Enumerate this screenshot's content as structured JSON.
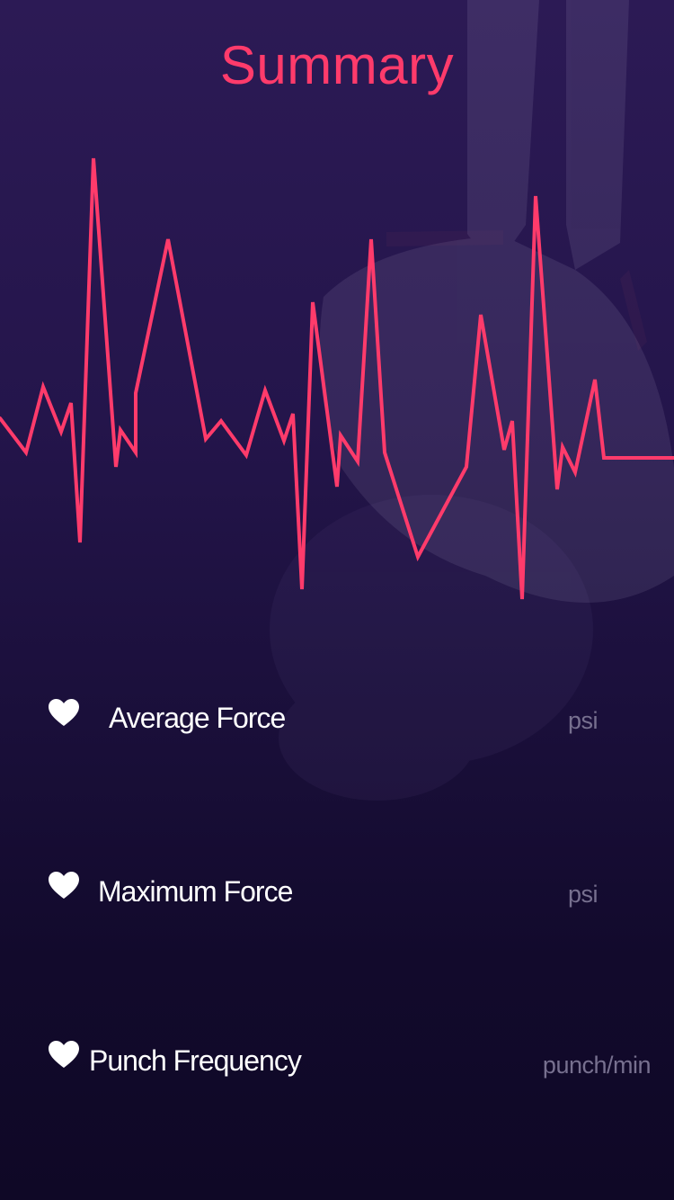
{
  "header": {
    "title": "Summary"
  },
  "metrics": [
    {
      "label": "Average Force",
      "unit": "psi",
      "icon": "heart-icon"
    },
    {
      "label": "Maximum Force",
      "unit": "psi",
      "icon": "heart-icon"
    },
    {
      "label": "Punch Frequency",
      "unit": "punch/min",
      "icon": "heart-icon"
    }
  ],
  "colors": {
    "accent": "#ff3b6b",
    "text": "#ffffff",
    "unit": "#77708f",
    "background_top": "#2c1a55",
    "background_bottom": "#0f0826"
  }
}
